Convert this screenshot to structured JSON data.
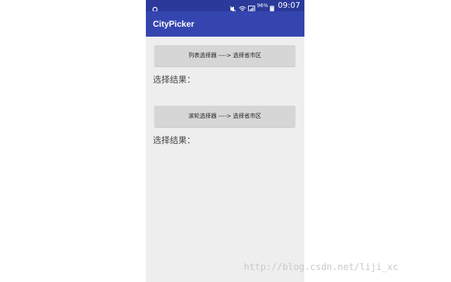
{
  "status_bar": {
    "battery_percent": "96%",
    "time": "09:07"
  },
  "app_bar": {
    "title": "CityPicker"
  },
  "main": {
    "list_picker_button": "列表选择器 ----> 选择省市区",
    "list_result_label": "选择结果：",
    "wheel_picker_button": "滚轮选择器 ----> 选择省市区",
    "wheel_result_label": "选择结果："
  },
  "watermark": "http://blog.csdn.net/liji_xc",
  "colors": {
    "status_bar": "#2b3a9a",
    "app_bar": "#3545b0",
    "background": "#eeeeee",
    "button": "#d6d6d6"
  },
  "icons": [
    "android-notification-icon",
    "mute-icon",
    "wifi-icon",
    "sim-signal-icon",
    "battery-icon"
  ]
}
